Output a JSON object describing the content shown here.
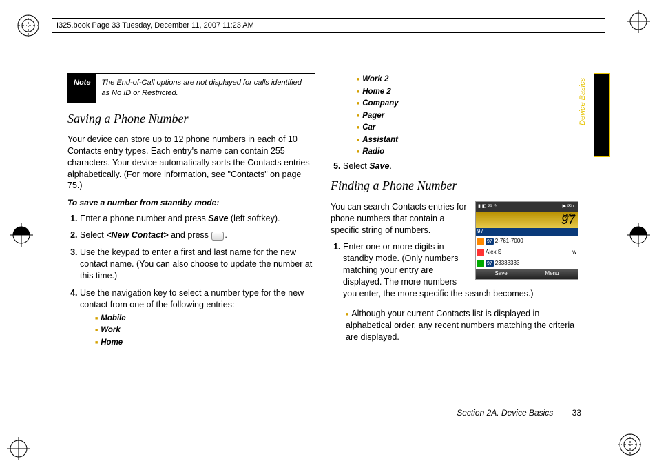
{
  "header": {
    "file_stamp": "I325.book  Page 33  Tuesday, December 11, 2007  11:23 AM"
  },
  "note": {
    "label": "Note",
    "text": "The End-of-Call options are not displayed for calls identified as No ID or Restricted."
  },
  "saving": {
    "heading": "Saving a Phone Number",
    "intro": "Your device can store up to 12 phone numbers in each of 10 Contacts entry types. Each entry's name can contain 255 characters. Your device automatically sorts the Contacts entries alphabetically. (For more information, see \"Contacts\" on page 75.)",
    "subhead": "To save a number from standby mode:",
    "step1_a": "Enter a phone number and press ",
    "step1_b": "Save",
    "step1_c": " (left softkey).",
    "step2_a": "Select ",
    "step2_b": "<New Contact>",
    "step2_c": " and press ",
    "step2_d": ".",
    "step3": "Use the keypad to enter a first and last name for the new contact name. (You can also choose to update the number at this time.)",
    "step4": "Use the navigation key to select a number type for the new contact from one of the following entries:",
    "types_a": [
      "Mobile",
      "Work",
      "Home"
    ]
  },
  "right": {
    "types_b": [
      "Work 2",
      "Home 2",
      "Company",
      "Pager",
      "Car",
      "Assistant",
      "Radio"
    ],
    "step5_a": "Select ",
    "step5_b": "Save",
    "step5_c": "."
  },
  "finding": {
    "heading": "Finding a Phone Number",
    "intro": "You can search Contacts entries for phone numbers that contain a specific string of numbers.",
    "step1": "Enter one or more digits in standby mode. (Only numbers matching your entry are displayed. The more numbers you enter, the more specific the search becomes.)",
    "sub": "Although your current Contacts list is displayed in alphabetical order, any recent numbers matching the criteria are displayed."
  },
  "phone": {
    "sprint": "Sprint",
    "big": "97",
    "bar_left": "97",
    "row1_num": "97",
    "row1_text": "2-761-7000",
    "row2_text": "Alex S",
    "row2_right": "w",
    "row3_num": "97",
    "row3_text": "23333333",
    "sk_left": "Save",
    "sk_right": "Menu"
  },
  "sidetab": "Device Basics",
  "footer": {
    "section": "Section 2A. Device Basics",
    "page": "33"
  }
}
